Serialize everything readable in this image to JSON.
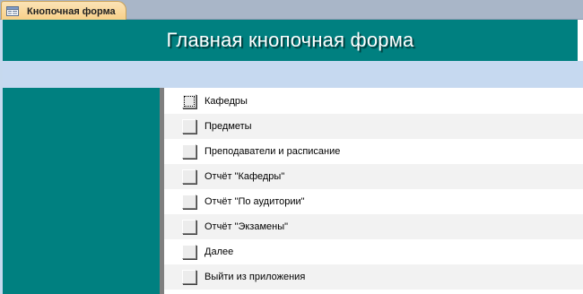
{
  "tab": {
    "label": "Кнопочная форма",
    "icon": "form-icon"
  },
  "form": {
    "title": "Главная кнопочная форма"
  },
  "colors": {
    "teal": "#008080",
    "band": "#c6d9f0",
    "tab": "#f8cf86"
  },
  "items": [
    {
      "label": "Кафедры",
      "focused": true
    },
    {
      "label": "Предметы"
    },
    {
      "label": "Преподаватели и расписание"
    },
    {
      "label": "Отчёт \"Кафедры\""
    },
    {
      "label": "Отчёт \"По аудитории\""
    },
    {
      "label": "Отчёт \"Экзамены\""
    },
    {
      "label": "Далее"
    },
    {
      "label": "Выйти из приложения"
    }
  ]
}
